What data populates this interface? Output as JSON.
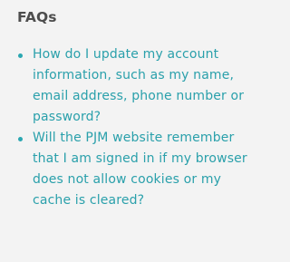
{
  "faq": {
    "title": "FAQs",
    "items": [
      {
        "label": "How do I update my account information, such as my name, email address, phone number or password?"
      },
      {
        "label": "Will the PJM website remember that I am signed in if my browser does not allow cookies or my cache is cleared?"
      }
    ]
  },
  "colors": {
    "background": "#f3f3f3",
    "title": "#4d4d4d",
    "link": "#2aa0ab",
    "bullet": "#2aa7b1"
  },
  "icons": {
    "bullet": "bullet-dot-icon"
  }
}
